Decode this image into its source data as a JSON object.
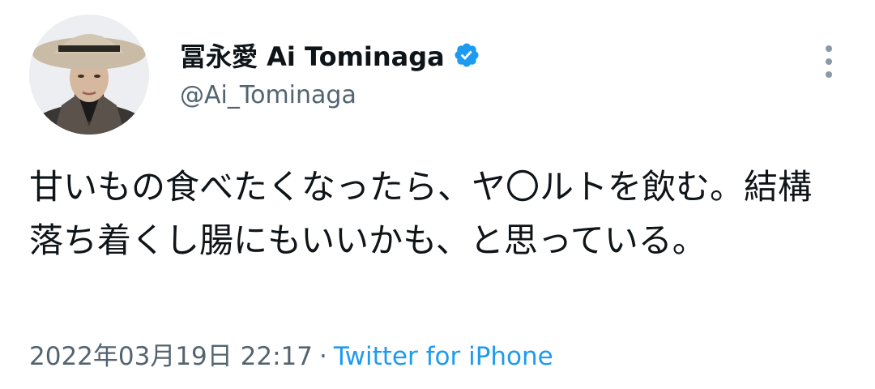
{
  "user": {
    "display_name": "冨永愛 Ai Tominaga",
    "handle": "@Ai_Tominaga",
    "verified_icon": "verified-badge-icon",
    "avatar_icon": "avatar-photo"
  },
  "tweet": {
    "text": "甘いもの食べたくなったら、ヤ〇ルトを飲む。結構落ち着くし腸にもいいかも、と思っている。",
    "timestamp": "2022年03月19日 22:17",
    "separator": "·",
    "source": "Twitter for iPhone"
  },
  "colors": {
    "text": "#0f1419",
    "secondary": "#536471",
    "accent": "#1d9bf0"
  },
  "menu": {
    "icon": "more-vertical-icon"
  }
}
